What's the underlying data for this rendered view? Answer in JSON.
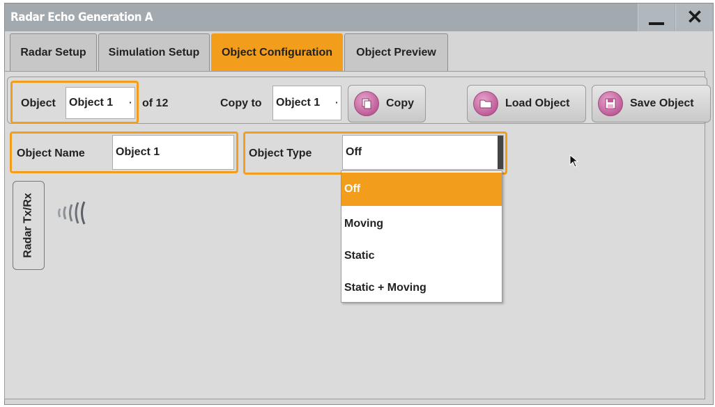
{
  "window": {
    "title": "Radar Echo Generation A",
    "minimize_icon": "minimize-icon",
    "close_icon": "close-icon"
  },
  "tabs": [
    {
      "label": "Radar Setup",
      "active": false
    },
    {
      "label": "Simulation Setup",
      "active": false
    },
    {
      "label": "Object Configuration",
      "active": true
    },
    {
      "label": "Object Preview",
      "active": false
    }
  ],
  "object_row": {
    "object_label": "Object",
    "object_value": "Object 1",
    "of_total": "of 12",
    "copy_to_label": "Copy to",
    "copy_to_value": "Object 1",
    "copy_button": "Copy",
    "load_button": "Load Object",
    "save_button": "Save Object"
  },
  "object_name": {
    "label": "Object Name",
    "value": "Object 1"
  },
  "object_type": {
    "label": "Object Type",
    "value": "Off",
    "options": [
      "Off",
      "Moving",
      "Static",
      "Static + Moving"
    ],
    "selected_index": 0
  },
  "radar": {
    "txrx_label": "Radar Tx/Rx",
    "wave_icon": "radar-wave-icon"
  },
  "colors": {
    "accent": "#f29d1c",
    "titlebar": "#a2aab0",
    "background": "#d6d6d6",
    "button_icon": "#c05d99"
  }
}
